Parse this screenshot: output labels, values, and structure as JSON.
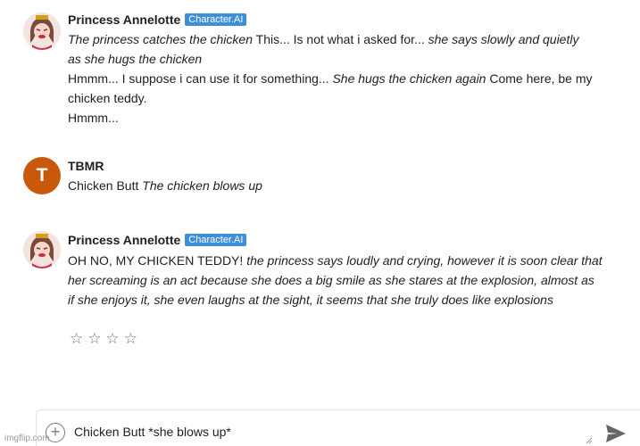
{
  "messages": [
    {
      "author": "Princess Annelotte",
      "badge": "Character.AI",
      "line1_a": "The princess catches the chicken",
      "line1_b": " This... Is not what i asked for... ",
      "line1_c": "she says slowly and quietly",
      "line2": "as she hugs the chicken",
      "line3_a": "Hmmm... I suppose i can use it for something... ",
      "line3_b": "She hugs the chicken again",
      "line3_c": " Come here, be my",
      "line4": "chicken teddy.",
      "line5": "Hmmm..."
    },
    {
      "author": "TBMR",
      "avatar_letter": "T",
      "line1_a": "Chicken Butt ",
      "line1_b": "The chicken blows up"
    },
    {
      "author": "Princess Annelotte",
      "badge": "Character.AI",
      "line1_a": "OH NO, MY CHICKEN TEDDY! ",
      "line1_b": "the princess says loudly and crying, however it is soon clear that",
      "line2": "her screaming is an act because she does a big smile as she stares at the explosion, almost as",
      "line3": "if she enjoys it, she even laughs at the sight, it seems that she truly does like explosions"
    }
  ],
  "rating": {
    "stars": [
      "☆",
      "☆",
      "☆",
      "☆"
    ]
  },
  "composer": {
    "value": "Chicken Butt *she blows up*",
    "plus_icon": "plus-circle-icon",
    "send_icon": "send-icon"
  },
  "watermark": "imgflip.com",
  "colors": {
    "badge": "#3f8fd8",
    "avatar_letter_bg": "#c8590a"
  }
}
